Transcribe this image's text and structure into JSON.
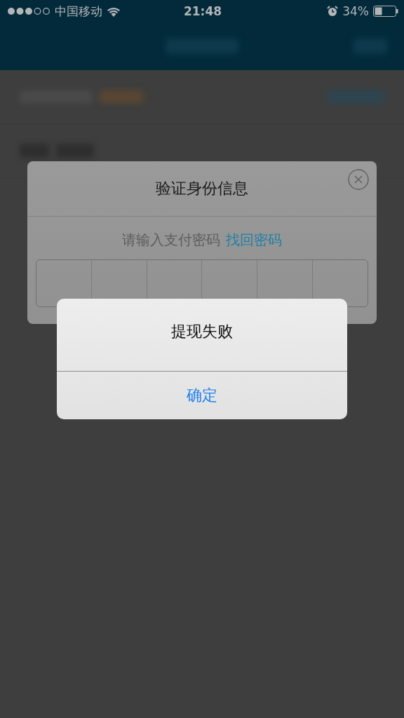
{
  "status_bar": {
    "carrier": "中国移动",
    "time": "21:48",
    "battery": "34%"
  },
  "verify_dialog": {
    "title": "验证身份信息",
    "prompt": "请输入支付密码",
    "link": "找回密码",
    "password_boxes": [
      {
        "filled": false
      },
      {
        "filled": false
      },
      {
        "filled": false
      },
      {
        "filled": false
      },
      {
        "filled": false
      },
      {
        "filled": false
      }
    ]
  },
  "alert": {
    "title": "提现失败",
    "button": "确定"
  }
}
